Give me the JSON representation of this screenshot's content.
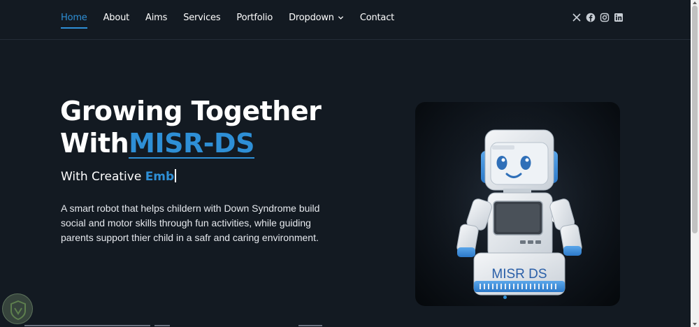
{
  "nav": {
    "items": [
      {
        "label": "Home",
        "active": true
      },
      {
        "label": "About"
      },
      {
        "label": "Aims"
      },
      {
        "label": "Services"
      },
      {
        "label": "Portfolio"
      },
      {
        "label": "Dropdown",
        "has_dropdown": true
      },
      {
        "label": "Contact"
      }
    ],
    "social_icons": [
      "x-icon",
      "facebook-icon",
      "instagram-icon",
      "linkedin-icon"
    ]
  },
  "hero": {
    "title_line1": "Growing Together",
    "title_line2_prefix": "With",
    "title_brand": "MISR-DS",
    "subtitle_prefix": "With Creative ",
    "subtitle_typed": "Emb",
    "description": "A smart robot that helps childern with Down Syndrome build social and motor skills through fun activities, while guiding parents support thier child in a safr and caring environment.",
    "robot_label": "MISR DS"
  },
  "colors": {
    "background": "#131a22",
    "accent": "#2e8fd6",
    "text": "#ffffff"
  }
}
